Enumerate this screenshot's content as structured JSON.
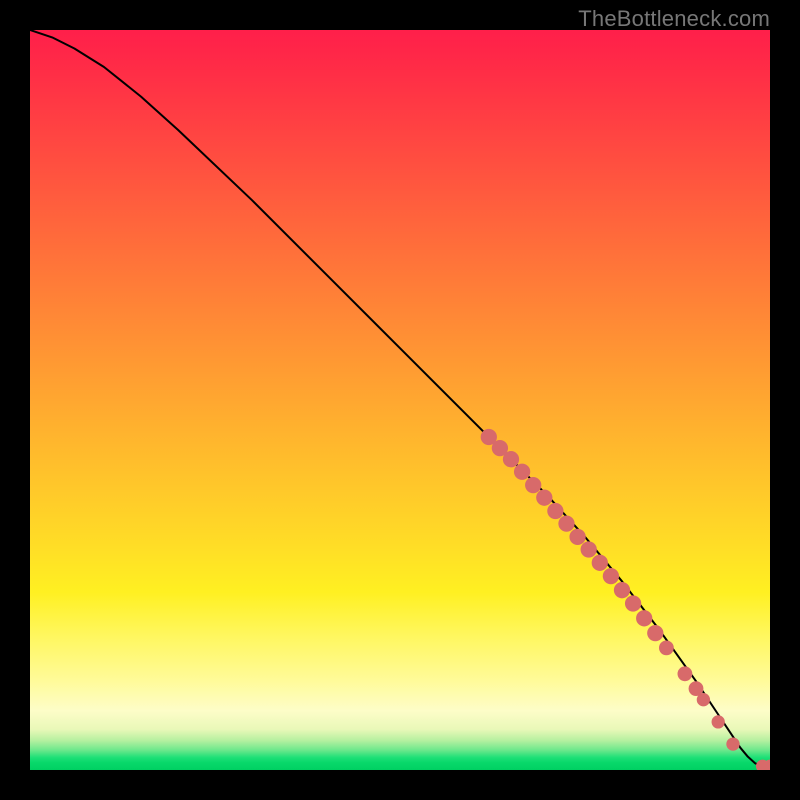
{
  "attribution": "TheBottleneck.com",
  "colors": {
    "page_bg": "#000000",
    "curve": "#000000",
    "marker_fill": "#d86a6a",
    "marker_stroke": "#b94f4f",
    "gradient_top": "#ff1f4a",
    "gradient_mid": "#ffde26",
    "gradient_bottom": "#00d062"
  },
  "chart_data": {
    "type": "line",
    "title": "",
    "xlabel": "",
    "ylabel": "",
    "xlim": [
      0,
      100
    ],
    "ylim": [
      0,
      100
    ],
    "series": [
      {
        "name": "curve",
        "x": [
          0,
          3,
          6,
          10,
          15,
          20,
          30,
          40,
          50,
          60,
          65,
          70,
          75,
          80,
          85,
          90,
          93,
          95,
          96,
          97,
          98,
          99,
          100
        ],
        "y": [
          100,
          99,
          97.5,
          95,
          91,
          86.5,
          77,
          67,
          57,
          47,
          42,
          37,
          31.5,
          25.5,
          19,
          12,
          7.5,
          4.5,
          3,
          1.8,
          0.9,
          0.45,
          0.45
        ]
      }
    ],
    "markers": [
      {
        "x": 62.0,
        "y": 45.0,
        "r": 1.1
      },
      {
        "x": 63.5,
        "y": 43.5,
        "r": 1.1
      },
      {
        "x": 65.0,
        "y": 42.0,
        "r": 1.1
      },
      {
        "x": 66.5,
        "y": 40.3,
        "r": 1.1
      },
      {
        "x": 68.0,
        "y": 38.5,
        "r": 1.1
      },
      {
        "x": 69.5,
        "y": 36.8,
        "r": 1.1
      },
      {
        "x": 71.0,
        "y": 35.0,
        "r": 1.1
      },
      {
        "x": 72.5,
        "y": 33.3,
        "r": 1.1
      },
      {
        "x": 74.0,
        "y": 31.5,
        "r": 1.1
      },
      {
        "x": 75.5,
        "y": 29.8,
        "r": 1.1
      },
      {
        "x": 77.0,
        "y": 28.0,
        "r": 1.1
      },
      {
        "x": 78.5,
        "y": 26.2,
        "r": 1.1
      },
      {
        "x": 80.0,
        "y": 24.3,
        "r": 1.1
      },
      {
        "x": 81.5,
        "y": 22.5,
        "r": 1.1
      },
      {
        "x": 83.0,
        "y": 20.5,
        "r": 1.1
      },
      {
        "x": 84.5,
        "y": 18.5,
        "r": 1.1
      },
      {
        "x": 86.0,
        "y": 16.5,
        "r": 1.0
      },
      {
        "x": 88.5,
        "y": 13.0,
        "r": 1.0
      },
      {
        "x": 90.0,
        "y": 11.0,
        "r": 1.0
      },
      {
        "x": 91.0,
        "y": 9.5,
        "r": 0.9
      },
      {
        "x": 93.0,
        "y": 6.5,
        "r": 0.9
      },
      {
        "x": 95.0,
        "y": 3.5,
        "r": 0.9
      },
      {
        "x": 99.0,
        "y": 0.5,
        "r": 0.9
      },
      {
        "x": 100.0,
        "y": 0.5,
        "r": 0.9
      }
    ]
  }
}
